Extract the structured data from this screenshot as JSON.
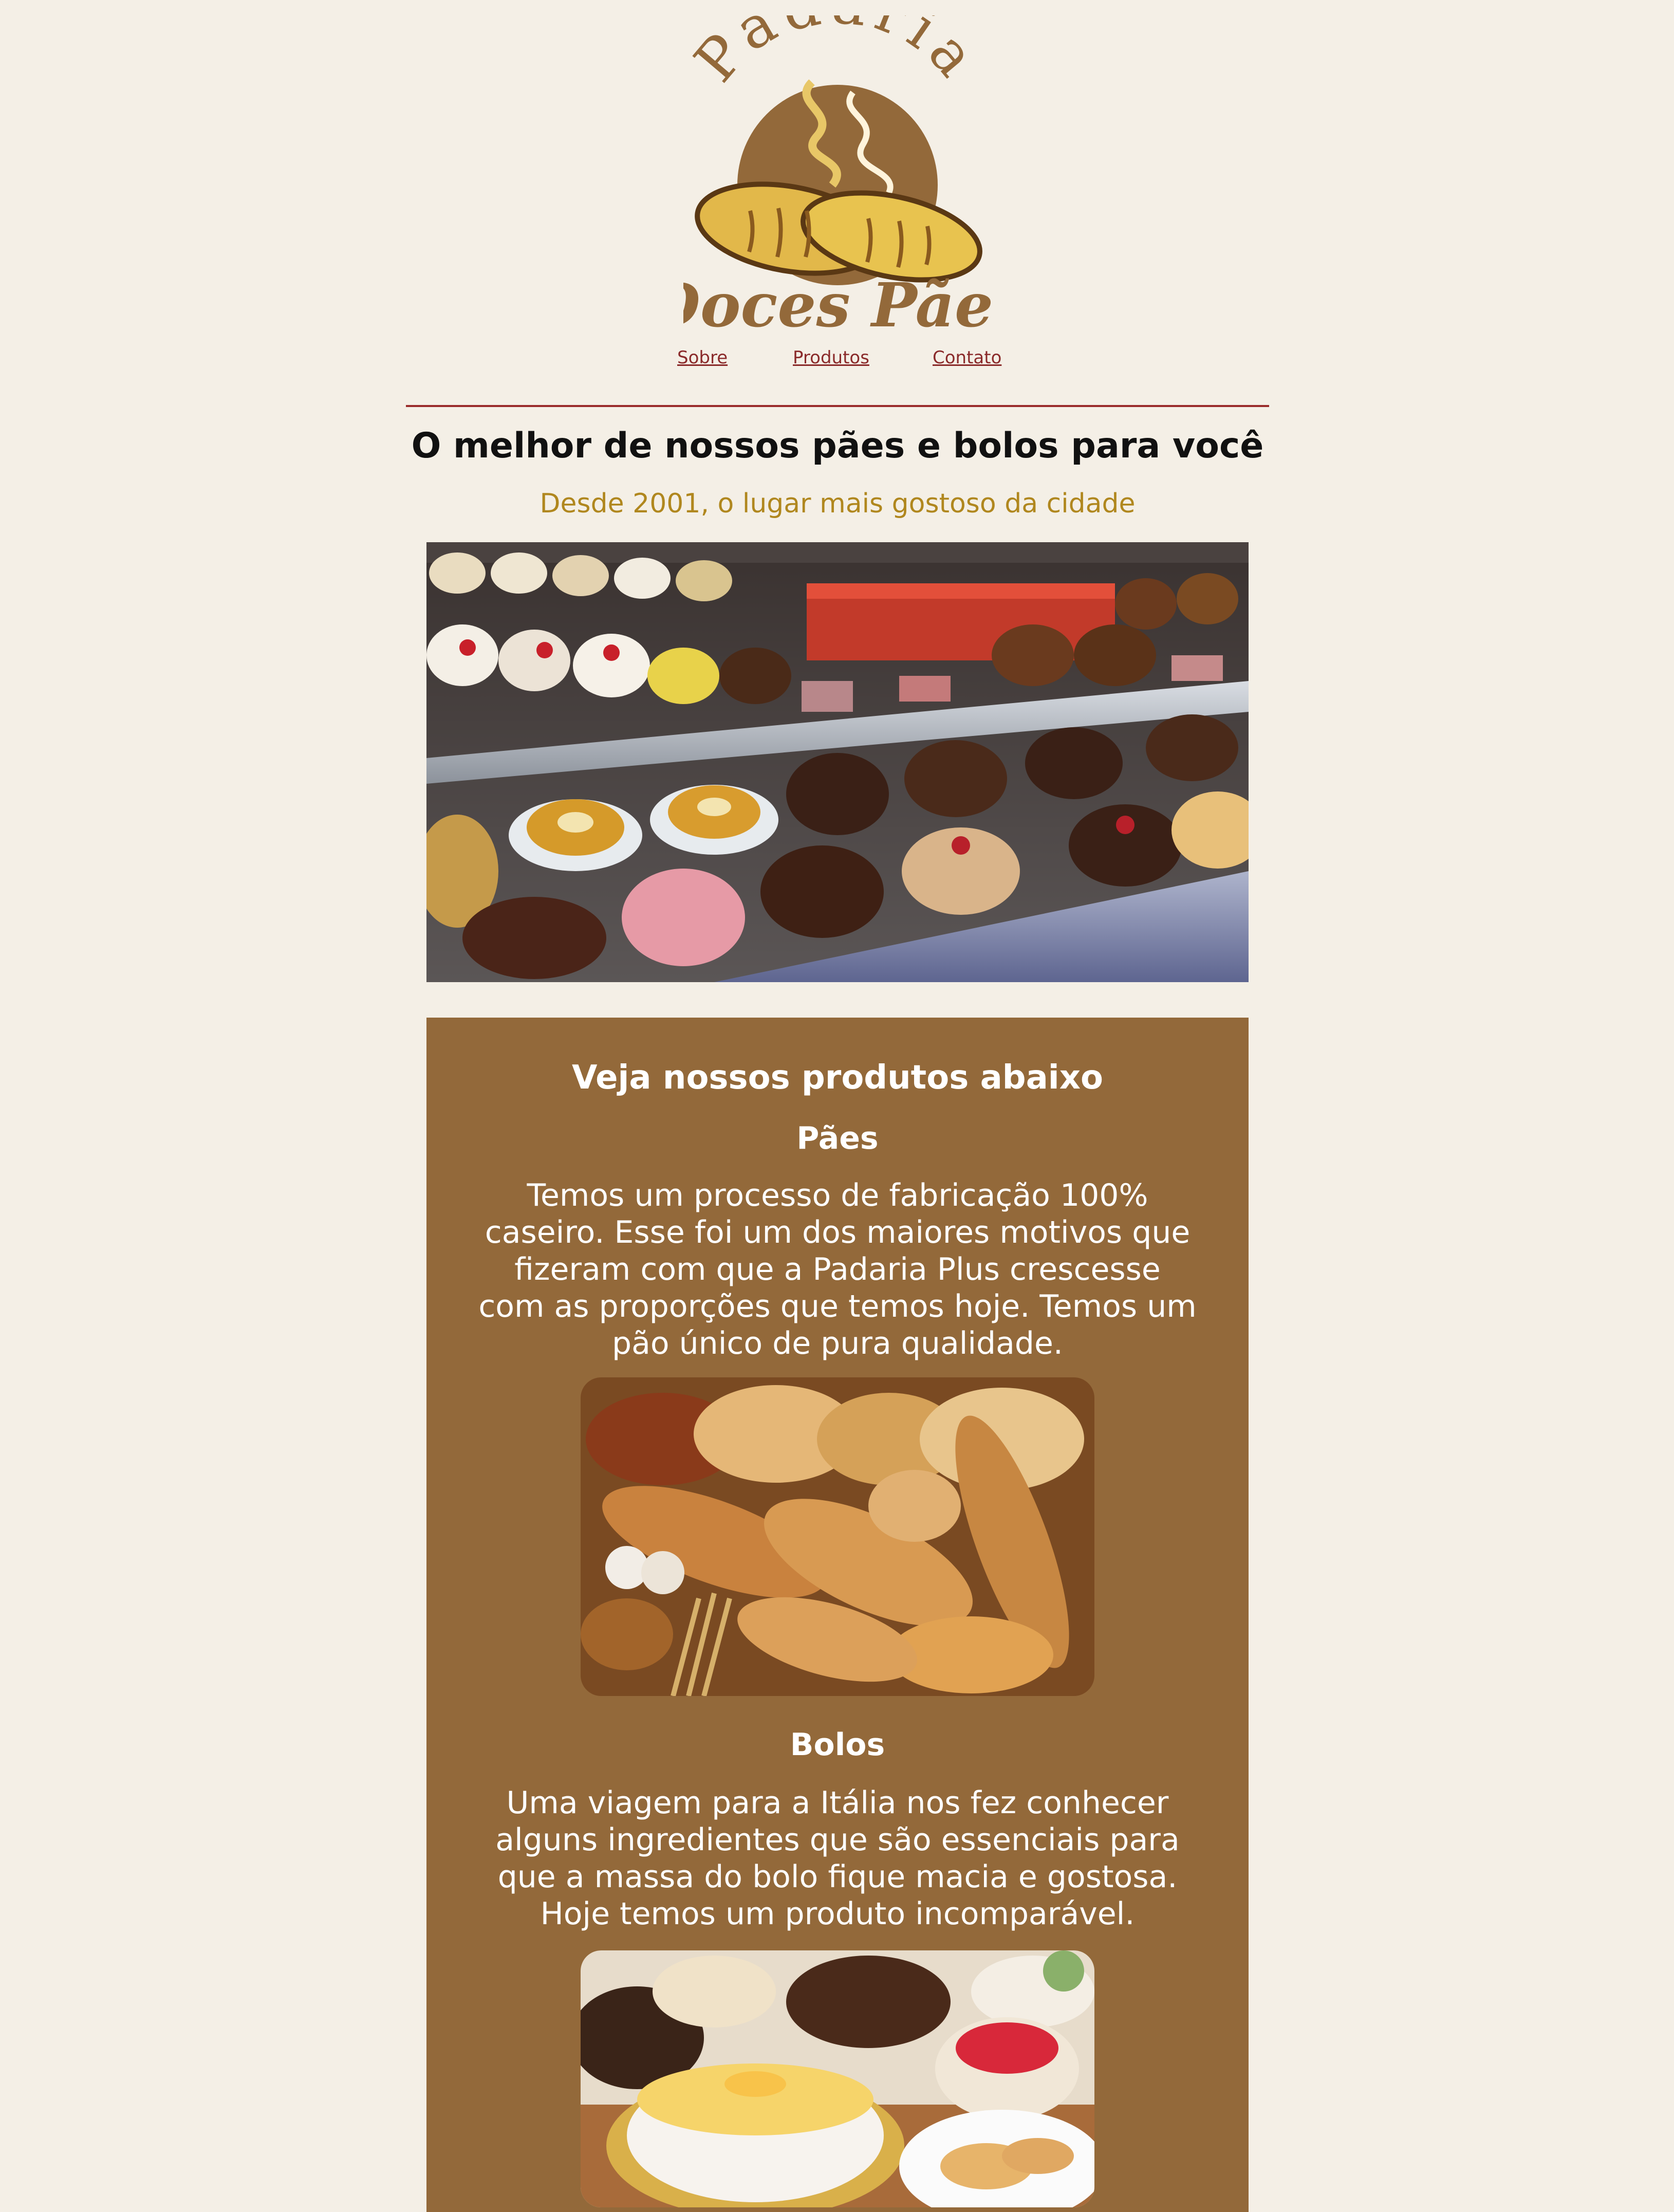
{
  "header": {
    "logo": {
      "top_text": "Padaria",
      "bottom_text": "Doces Pães",
      "icon": "bread-logo-icon",
      "colors": {
        "brown": "#93693a",
        "bread": "#e2b84a",
        "dark": "#6a4418"
      }
    },
    "nav": [
      {
        "label": "Sobre"
      },
      {
        "label": "Produtos"
      },
      {
        "label": "Contato"
      }
    ],
    "link_color": "#8a2a2a"
  },
  "hero": {
    "title": "O melhor de nossos pães e bolos para você",
    "subtitle": "Desde 2001, o lugar mais gostoso da cidade",
    "image": "bakery-display-case-photo"
  },
  "products": {
    "heading": "Veja nossos produtos abaixo",
    "background": "#93693a",
    "items": [
      {
        "title": "Pães",
        "text": "Temos um processo de fabricação 100% caseiro. Esse foi um dos maiores motivos que fizeram com que a Padaria Plus crescesse com as proporções que temos hoje. Temos um pão único de pura qualidade.",
        "image": "breads-photo"
      },
      {
        "title": "Bolos",
        "text": "Uma viagem para a Itália nos fez conhecer alguns ingredientes que são essenciais para que a massa do bolo fique macia e gostosa. Hoje temos um produto incomparável.",
        "image": "cakes-photo"
      }
    ]
  }
}
